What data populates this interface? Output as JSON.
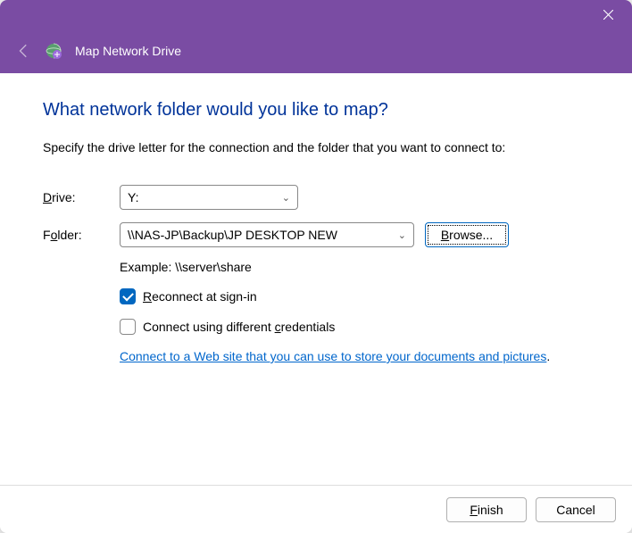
{
  "header": {
    "title": "Map Network Drive"
  },
  "content": {
    "heading": "What network folder would you like to map?",
    "description": "Specify the drive letter for the connection and the folder that you want to connect to:",
    "drive": {
      "label_pre": "",
      "label_accel": "D",
      "label_post": "rive:",
      "value": "Y:"
    },
    "folder": {
      "label_pre": "F",
      "label_accel": "o",
      "label_post": "lder:",
      "value": "\\\\NAS-JP\\Backup\\JP DESKTOP NEW"
    },
    "browse": {
      "pre": "",
      "accel": "B",
      "post": "rowse..."
    },
    "example": "Example: \\\\server\\share",
    "reconnect": {
      "checked": true,
      "pre": "",
      "accel": "R",
      "post": "econnect at sign-in"
    },
    "credentials": {
      "checked": false,
      "pre": "Connect using different ",
      "accel": "c",
      "post": "redentials"
    },
    "link": "Connect to a Web site that you can use to store your documents and pictures",
    "link_suffix": "."
  },
  "footer": {
    "finish": {
      "pre": "",
      "accel": "F",
      "post": "inish"
    },
    "cancel": "Cancel"
  }
}
